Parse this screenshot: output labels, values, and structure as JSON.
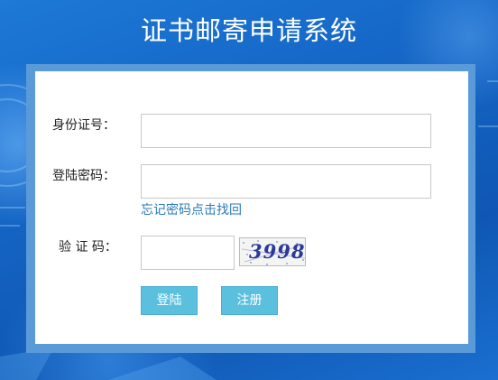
{
  "page": {
    "title": "证书邮寄申请系统"
  },
  "form": {
    "id_label": "身份证号：",
    "id_value": "",
    "password_label": "登陆密码：",
    "password_value": "",
    "forgot_link": "忘记密码点击找回",
    "captcha_label": "验 证 码：",
    "captcha_value": "",
    "captcha_text": "3998"
  },
  "buttons": {
    "login": "登陆",
    "register": "注册"
  },
  "colors": {
    "background": "#1560b8",
    "frame": "#5a9ad8",
    "button": "#5bc0de",
    "link": "#2a7ab8"
  }
}
